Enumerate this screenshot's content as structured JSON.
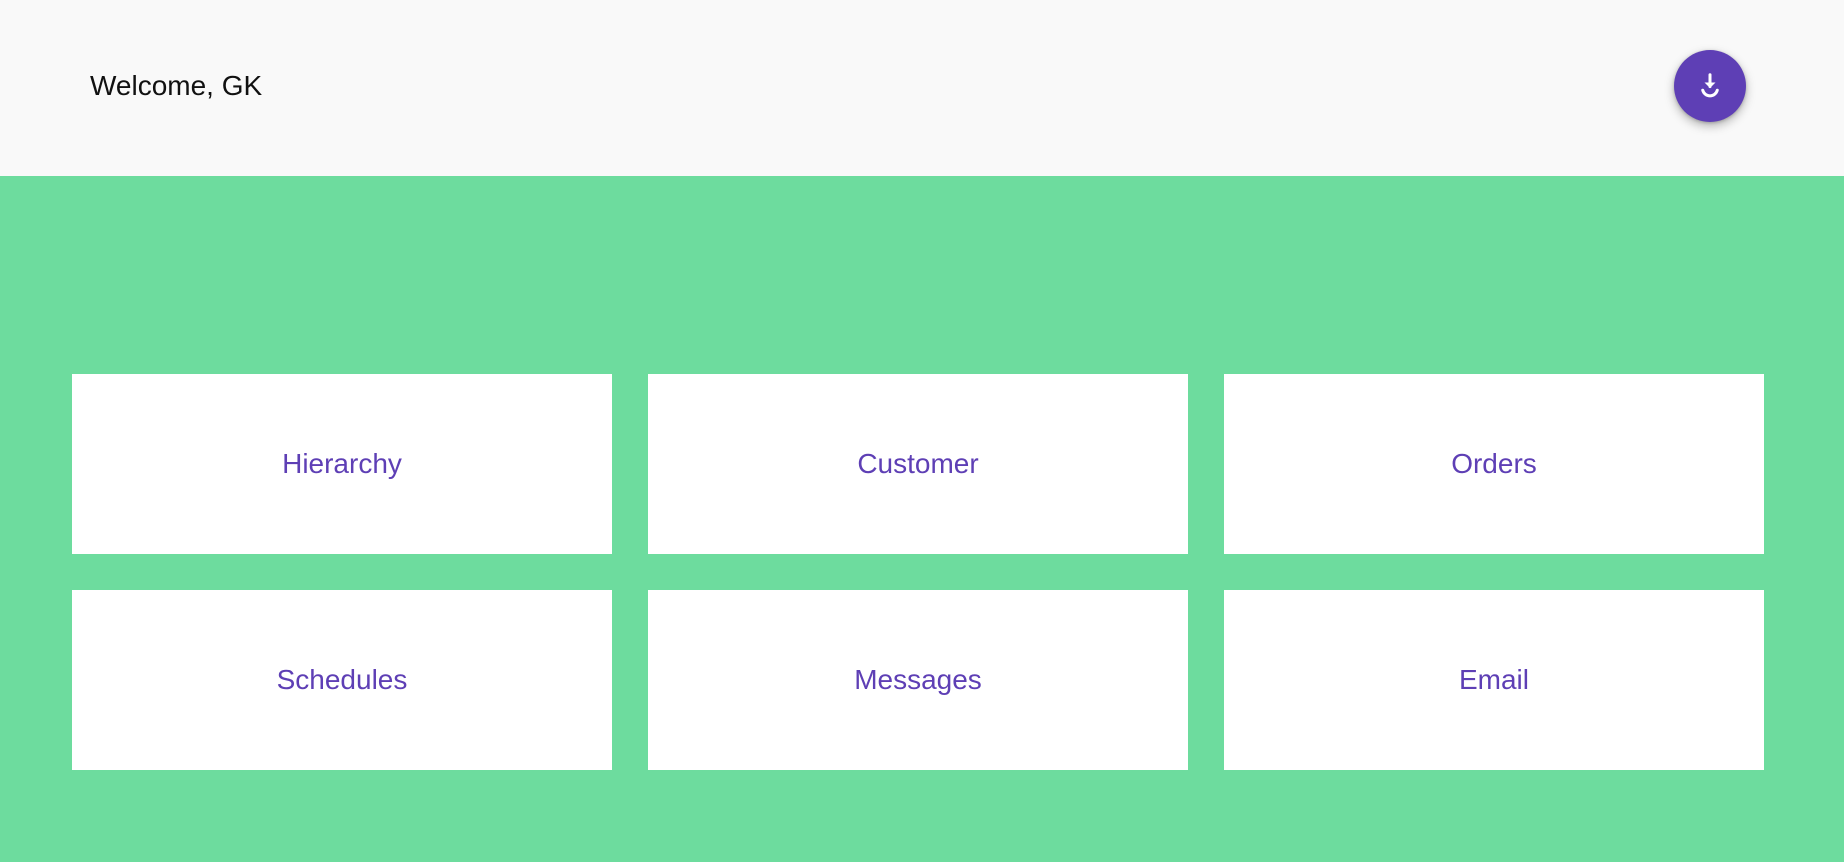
{
  "header": {
    "welcome_text": "Welcome, GK",
    "download_button": {
      "icon": "download-icon",
      "color": "#5e3fb5"
    }
  },
  "colors": {
    "page_background": "#6ddc9e",
    "header_background": "#f9f9f9",
    "tile_background": "#ffffff",
    "tile_text": "#5e3fb5"
  },
  "tiles": [
    {
      "label": "Hierarchy"
    },
    {
      "label": "Customer"
    },
    {
      "label": "Orders"
    },
    {
      "label": "Schedules"
    },
    {
      "label": "Messages"
    },
    {
      "label": "Email"
    }
  ]
}
